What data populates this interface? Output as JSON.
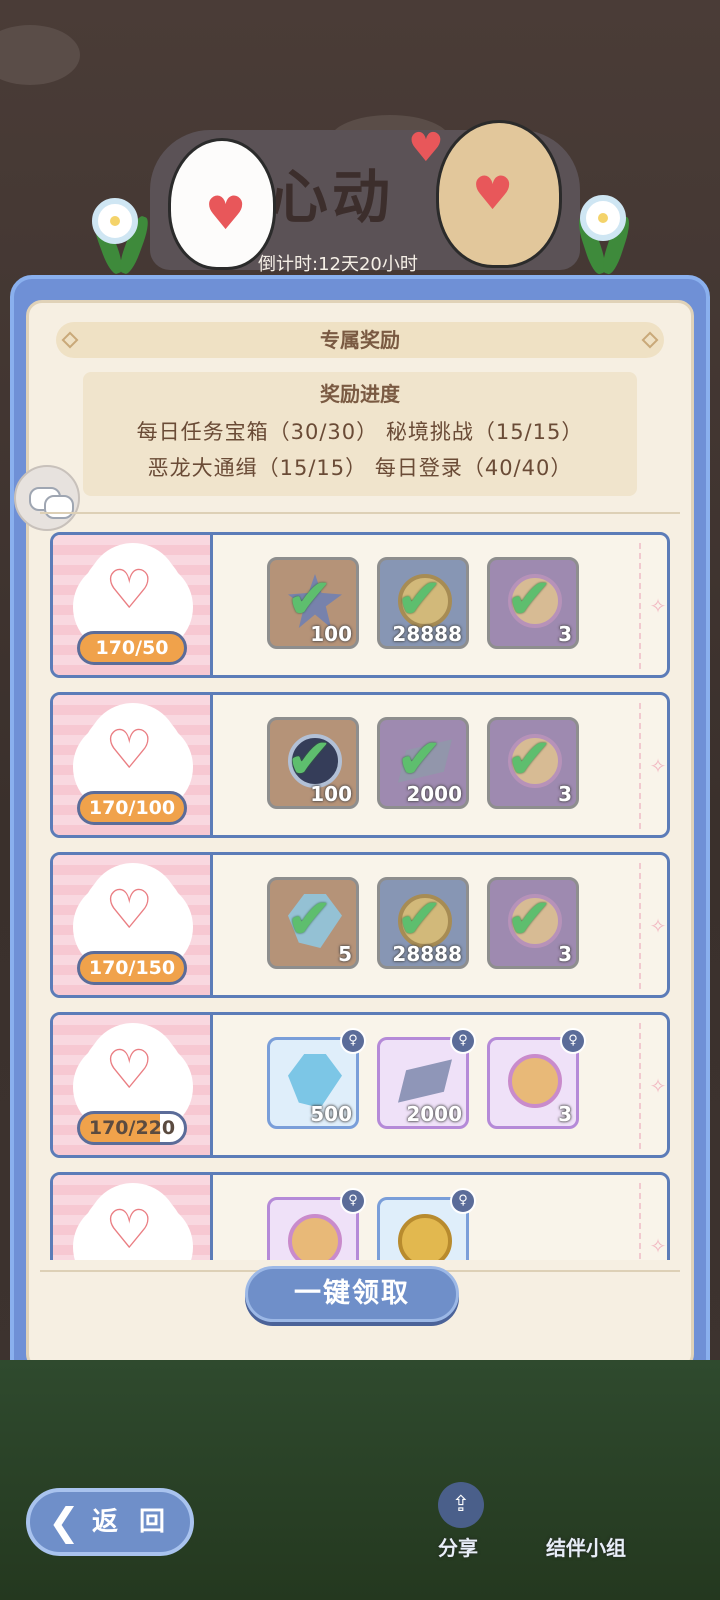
{
  "event": {
    "banner_title": "心动",
    "countdown": "倒计时:12天20小时"
  },
  "panel": {
    "title": "专属奖励",
    "progress": {
      "title": "奖励进度",
      "line1": "每日任务宝箱（30/30）  秘境挑战（15/15）",
      "line2": "恶龙大通缉（15/15）  每日登录（40/40）"
    }
  },
  "tiers": [
    {
      "count": "170/50",
      "claimed": true,
      "items": [
        {
          "name": "star-crystal",
          "qty": "100"
        },
        {
          "name": "gold-token",
          "qty": "28888"
        },
        {
          "name": "pet-token",
          "qty": "3"
        }
      ]
    },
    {
      "count": "170/100",
      "claimed": true,
      "items": [
        {
          "name": "cat-orb",
          "qty": "100"
        },
        {
          "name": "iron-bar",
          "qty": "2000"
        },
        {
          "name": "pet-token",
          "qty": "3"
        }
      ]
    },
    {
      "count": "170/150",
      "claimed": true,
      "items": [
        {
          "name": "blue-crystal",
          "qty": "5"
        },
        {
          "name": "gold-token",
          "qty": "28888"
        },
        {
          "name": "pet-token",
          "qty": "3"
        }
      ]
    },
    {
      "count": "170/220",
      "claimed": false,
      "progress": 0.77,
      "items": [
        {
          "name": "blue-crystal",
          "qty": "500"
        },
        {
          "name": "iron-bar",
          "qty": "2000"
        },
        {
          "name": "pet-token",
          "qty": "3"
        }
      ]
    },
    {
      "count": "",
      "claimed": false,
      "items": [
        {
          "name": "pet-token",
          "qty": ""
        },
        {
          "name": "gold-token",
          "qty": ""
        }
      ]
    }
  ],
  "collect_button": "一键领取",
  "bottom_nav": {
    "back": "返 回",
    "share": "分享",
    "partner": "结伴小组"
  },
  "colors": {
    "panel_blue": "#6f90d6",
    "badge_orange": "#f0a24b",
    "check_green": "#2fd04a"
  }
}
